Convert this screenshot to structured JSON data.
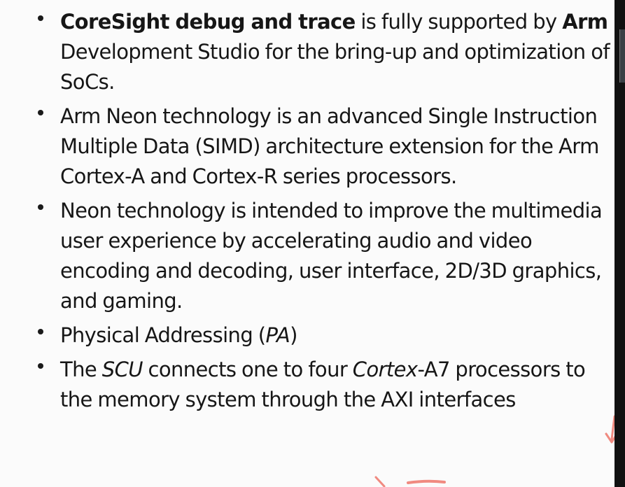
{
  "slide": {
    "bullets": [
      {
        "segments": [
          {
            "text": "CoreSight debug and trace",
            "style": "bold"
          },
          {
            "text": " is fully supported by ",
            "style": "normal"
          },
          {
            "text": "Arm",
            "style": "bold"
          },
          {
            "text": " Development Studio for the bring-up and optimization of SoCs.",
            "style": "normal"
          }
        ]
      },
      {
        "segments": [
          {
            "text": "Arm Neon technology is an advanced Single Instruction Multiple Data (SIMD) architecture extension for the Arm Cortex-A and Cortex-R series processors.",
            "style": "normal"
          }
        ]
      },
      {
        "segments": [
          {
            "text": "Neon technology is intended to improve the multimedia user experience by accelerating audio and video encoding and decoding, user interface, 2D/3D graphics, and gaming.",
            "style": "normal"
          }
        ]
      },
      {
        "segments": [
          {
            "text": "Physical Addressing (",
            "style": "normal"
          },
          {
            "text": "PA",
            "style": "italic"
          },
          {
            "text": ")",
            "style": "normal"
          }
        ]
      },
      {
        "segments": [
          {
            "text": "The ",
            "style": "normal"
          },
          {
            "text": "SCU",
            "style": "italic"
          },
          {
            "text": " connects one to four ",
            "style": "normal"
          },
          {
            "text": "Cortex",
            "style": "italic"
          },
          {
            "text": "-A7 processors to the memory system through the AXI interfaces",
            "style": "normal"
          }
        ]
      }
    ]
  },
  "annotations": {
    "ink_color": "#f08a80"
  }
}
